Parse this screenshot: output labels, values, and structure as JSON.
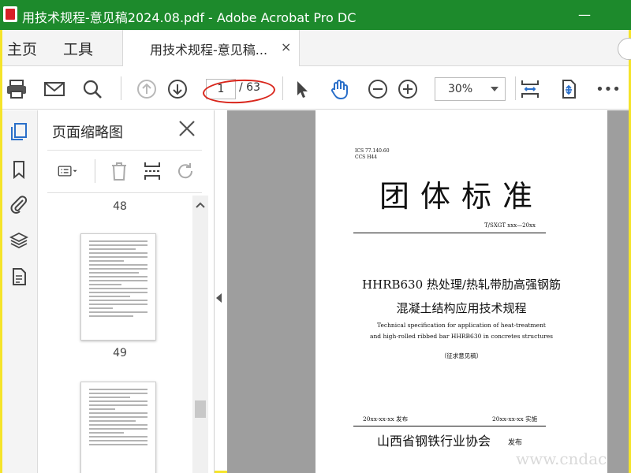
{
  "window": {
    "title": "用技术规程-意见稿2024.08.pdf - Adobe Acrobat Pro DC",
    "minimize": "—"
  },
  "tabs": {
    "home": "主页",
    "tools": "工具",
    "document": "用技术规程-意见稿...",
    "close": "×"
  },
  "toolbar": {
    "current_page": "1",
    "page_total": "/ 63",
    "zoom": "30%",
    "accent_color": "#2a6fc9",
    "more": "•••"
  },
  "thumbnail_panel": {
    "title": "页面缩略图",
    "pages": [
      "48",
      "49"
    ]
  },
  "document_page": {
    "ics": "ICS 77.140.60",
    "ccs": "CCS H44",
    "category": "团体标准",
    "standard_number": "T/SXGT xxx—20xx",
    "title_line1": "HHRB630 热处理/热轧带肋高强钢筋",
    "title_line2": "混凝土结构应用技术规程",
    "english_line1": "Technical specification for application of heat-treatment",
    "english_line2": "and high-rolled ribbed bar HHRB630 in concretes structures",
    "draft_label": "（征求意见稿）",
    "publish_date": "20xx-xx-xx 发布",
    "implement_date": "20xx-xx-xx 实施",
    "organization": "山西省钢铁行业协会",
    "publish_suffix": "发布"
  },
  "watermark": "www.cndac"
}
